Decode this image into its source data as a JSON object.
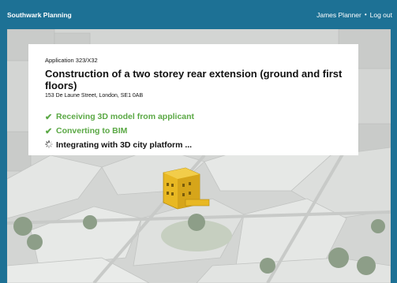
{
  "header": {
    "brand": "Southwark Planning",
    "user_name": "James Planner",
    "separator": "•",
    "logout": "Log out"
  },
  "application": {
    "reference": "Application 323/X32",
    "title": "Construction of a two storey rear extension (ground and first floors)",
    "address": "153 De Laune Street, London, SE1 0AB"
  },
  "steps": [
    {
      "label": "Receiving 3D model from applicant",
      "status": "done",
      "icon": "check-icon"
    },
    {
      "label": "Converting to BIM",
      "status": "done",
      "icon": "check-icon"
    },
    {
      "label": "Integrating with 3D city platform ...",
      "status": "in-progress",
      "icon": "spinner-icon"
    }
  ],
  "colors": {
    "header_bg": "#1d7195",
    "done_green": "#5aa844",
    "highlight_building": "#e8b823"
  }
}
